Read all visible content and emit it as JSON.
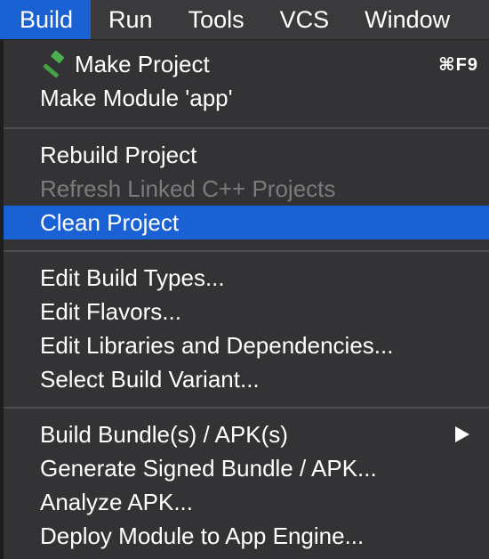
{
  "menubar": {
    "items": [
      {
        "label": "Build"
      },
      {
        "label": "Run"
      },
      {
        "label": "Tools"
      },
      {
        "label": "VCS"
      },
      {
        "label": "Window"
      }
    ]
  },
  "build_menu": {
    "make_project": {
      "label": "Make Project",
      "shortcut": "⌘F9",
      "icon": "hammer-icon"
    },
    "make_module": {
      "label": "Make Module 'app'"
    },
    "rebuild_project": {
      "label": "Rebuild Project"
    },
    "refresh_cpp": {
      "label": "Refresh Linked C++ Projects",
      "enabled": false
    },
    "clean_project": {
      "label": "Clean Project",
      "highlighted": true
    },
    "edit_build_types": {
      "label": "Edit Build Types..."
    },
    "edit_flavors": {
      "label": "Edit Flavors..."
    },
    "edit_libraries": {
      "label": "Edit Libraries and Dependencies..."
    },
    "select_build_variant": {
      "label": "Select Build Variant..."
    },
    "build_bundles": {
      "label": "Build Bundle(s) / APK(s)",
      "submenu": true
    },
    "generate_signed": {
      "label": "Generate Signed Bundle / APK..."
    },
    "analyze_apk": {
      "label": "Analyze APK..."
    },
    "deploy_module": {
      "label": "Deploy Module to App Engine..."
    }
  },
  "colors": {
    "accent": "#1a62d3",
    "menu_bg": "#333335",
    "disabled_text": "#7b7b7d"
  }
}
